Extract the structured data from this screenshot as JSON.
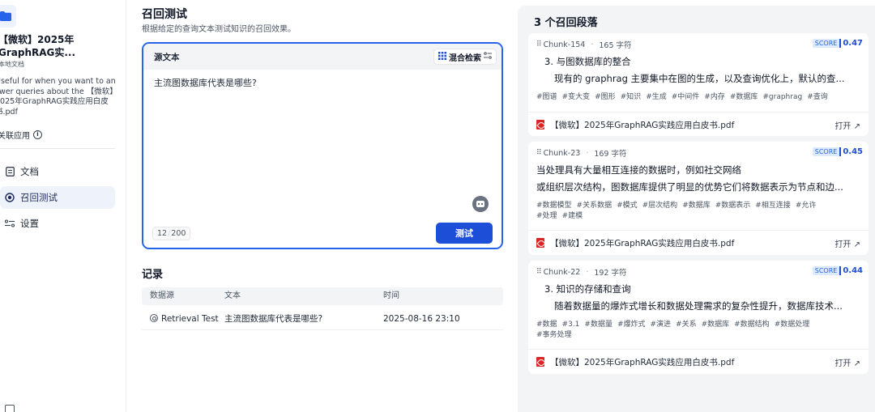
{
  "sidebar": {
    "kb_title": "【微软】2025年GraphRAG实...",
    "kb_type": "本地文档",
    "kb_description": "Useful for when you want to answer queries about the 【微软】2025年GraphRAG实践应用白皮书.pdf",
    "linked_apps": "关联应用",
    "nav": [
      {
        "label": "文档",
        "icon": "document-icon"
      },
      {
        "label": "召回测试",
        "icon": "target-icon",
        "active": true
      },
      {
        "label": "设置",
        "icon": "settings-sliders-icon"
      }
    ]
  },
  "main": {
    "title": "召回测试",
    "subtitle": "根据给定的查询文本测试知识的召回效果。",
    "query": {
      "label": "源文本",
      "mode": "混合检索",
      "text": "主流图数据库代表是哪些?",
      "count": "12",
      "limit": "200",
      "test_button": "测试"
    },
    "records": {
      "title": "记录",
      "headers": [
        "数据源",
        "文本",
        "时间"
      ],
      "rows": [
        {
          "source": "Retrieval Test",
          "text": "主流图数据库代表是哪些?",
          "time": "2025-08-16 23:10"
        }
      ]
    }
  },
  "results": {
    "title": "3 个召回段落",
    "accent_color": "#1d4ed8",
    "chunks": [
      {
        "id": "Chunk-154",
        "chars": "165 字符",
        "score_label": "SCORE",
        "score": "0.47",
        "line1": "3. 与图数据库的整合",
        "line2": "现有的 graphrag 主要集中在图的生成，以及查询优化上，默认的查...",
        "tags": [
          "#图谱",
          "#变大变",
          "#图形",
          "#知识",
          "#生成",
          "#中间件",
          "#内存",
          "#数据库",
          "#graphrag",
          "#查询"
        ],
        "doc": "【微软】2025年GraphRAG实践应用白皮书.pdf",
        "open": "打开 ↗"
      },
      {
        "id": "Chunk-23",
        "chars": "169 字符",
        "score_label": "SCORE",
        "score": "0.45",
        "line1": "当处理具有大量相互连接的数据时，例如社交网络",
        "line2": "或组织层次结构，图数据库提供了明显的优势它们将数据表示为节点和边...",
        "tags": [
          "#数据模型",
          "#关系数据",
          "#模式",
          "#层次结构",
          "#数据库",
          "#数据表示",
          "#相互连接",
          "#允许",
          "#处理",
          "#建模"
        ],
        "doc": "【微软】2025年GraphRAG实践应用白皮书.pdf",
        "open": "打开 ↗"
      },
      {
        "id": "Chunk-22",
        "chars": "192 字符",
        "score_label": "SCORE",
        "score": "0.44",
        "line1": "3. 知识的存储和查询",
        "line2": "随着数据量的爆炸式增长和数据处理需求的复杂性提升，数据库技术...",
        "tags": [
          "#数据",
          "#3.1",
          "#数据量",
          "#爆炸式",
          "#演进",
          "#关系",
          "#数据库",
          "#数据结构",
          "#数据处理",
          "#事务处理"
        ],
        "doc": "【微软】2025年GraphRAG实践应用白皮书.pdf",
        "open": "打开 ↗"
      }
    ]
  }
}
